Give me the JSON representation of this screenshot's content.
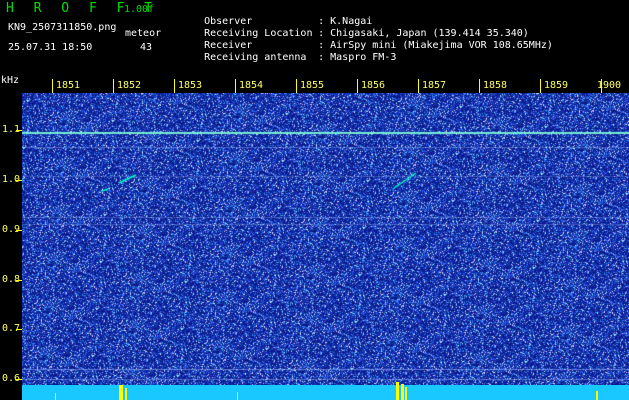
{
  "header": {
    "brand": "H R O F F T",
    "version": "1.00f",
    "filename": "KN9_2507311850.png",
    "mode_label": "meteor",
    "datetime": "25.07.31 18:50",
    "count": "43"
  },
  "info": [
    {
      "label": "Observer",
      "value": ": K.Nagai"
    },
    {
      "label": "Receiving Location",
      "value": ": Chigasaki, Japan (139.414 35.340)"
    },
    {
      "label": "Receiver",
      "value": ": AirSpy mini (Miakejima VOR 108.65MHz)"
    },
    {
      "label": "Receiving antenna",
      "value": ": Maspro FM-3"
    }
  ],
  "axis": {
    "y_unit": "kHz",
    "y_ticks": [
      "1.1",
      "1.0",
      "0.9",
      "0.8",
      "0.7",
      "0.6"
    ],
    "x_ticks": [
      "1851",
      "1852",
      "1853",
      "1854",
      "1855",
      "1856",
      "1857",
      "1858",
      "1859",
      "1900"
    ]
  },
  "colors": {
    "background": "#000000",
    "spectrum_base": "#0b1a8a",
    "noise": "#5d8cff",
    "signal": "#00ffcc",
    "tick_text": "#ffff66",
    "scan_bar": "#18c8ff",
    "peak": "#ffff00"
  }
}
